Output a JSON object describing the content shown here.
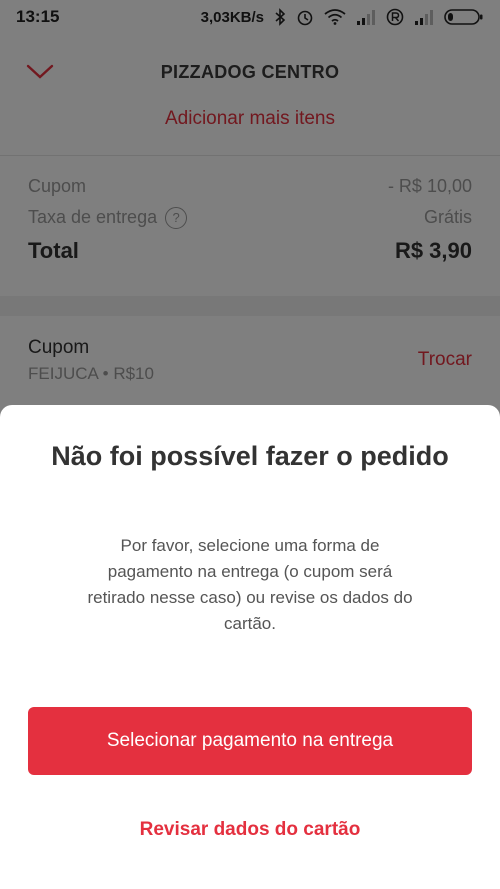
{
  "status_bar": {
    "time": "13:15",
    "network_speed": "3,03KB/s",
    "icons": [
      "bluetooth-icon",
      "alarm-icon",
      "wifi-icon",
      "signal-icon",
      "r-icon",
      "signal-icon",
      "battery-icon"
    ]
  },
  "header": {
    "title": "PIZZADOG CENTRO",
    "back_icon": "chevron-down-icon"
  },
  "order": {
    "add_items_label": "Adicionar mais itens",
    "coupon_label": "Cupom",
    "coupon_value": "- R$ 10,00",
    "delivery_fee_label": "Taxa de entrega",
    "delivery_fee_value": "Grátis",
    "help_icon_glyph": "?",
    "total_label": "Total",
    "total_value": "R$ 3,90"
  },
  "coupon_section": {
    "title": "Cupom",
    "code": "FEIJUCA",
    "separator": "•",
    "amount": "R$10",
    "action_label": "Trocar"
  },
  "dialog": {
    "title": "Não foi possível fazer o pedido",
    "message": "Por favor, selecione uma forma de pagamento na entrega (o cupom será retirado nesse caso) ou revise os dados do cartão.",
    "primary_button": "Selecionar pagamento na entrega",
    "secondary_link": "Revisar dados do cartão"
  },
  "colors": {
    "accent": "#e4303f",
    "overlay": "rgba(0,0,0,0.5)"
  }
}
